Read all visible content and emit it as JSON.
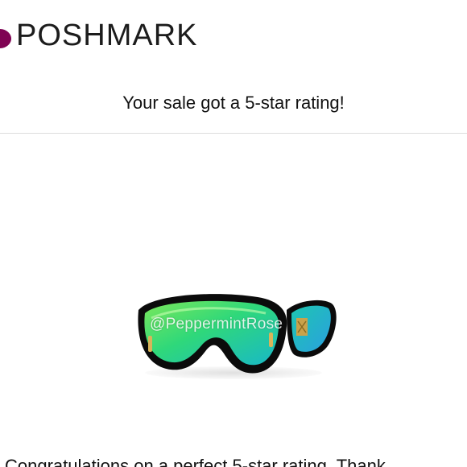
{
  "header": {
    "brand_name": "POSHMARK",
    "logo_icon": "poshmark-logo-icon",
    "brand_color": "#7f0353"
  },
  "main": {
    "headline": "Your sale got a 5-star rating!",
    "product_image": {
      "description_icon": "sunglasses-image",
      "watermark": "@PeppermintRose",
      "lens_colors": [
        "#2fd87a",
        "#18b8c8",
        "#7be85a"
      ],
      "frame_color": "#0b0b0b"
    },
    "message_start": "Congratulations on a perfect 5-star rating. Thank"
  }
}
